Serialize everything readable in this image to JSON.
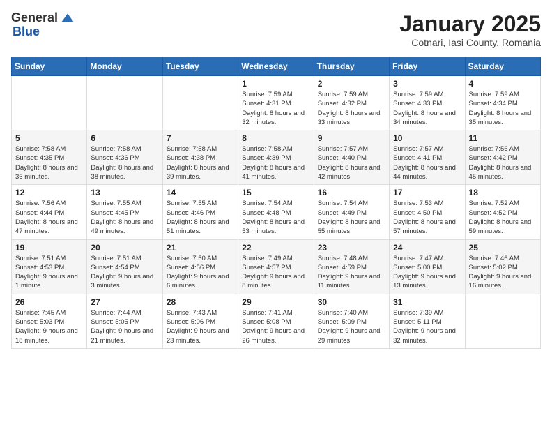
{
  "header": {
    "logo_general": "General",
    "logo_blue": "Blue",
    "month": "January 2025",
    "location": "Cotnari, Iasi County, Romania"
  },
  "weekdays": [
    "Sunday",
    "Monday",
    "Tuesday",
    "Wednesday",
    "Thursday",
    "Friday",
    "Saturday"
  ],
  "weeks": [
    [
      {
        "day": "",
        "info": ""
      },
      {
        "day": "",
        "info": ""
      },
      {
        "day": "",
        "info": ""
      },
      {
        "day": "1",
        "info": "Sunrise: 7:59 AM\nSunset: 4:31 PM\nDaylight: 8 hours and 32 minutes."
      },
      {
        "day": "2",
        "info": "Sunrise: 7:59 AM\nSunset: 4:32 PM\nDaylight: 8 hours and 33 minutes."
      },
      {
        "day": "3",
        "info": "Sunrise: 7:59 AM\nSunset: 4:33 PM\nDaylight: 8 hours and 34 minutes."
      },
      {
        "day": "4",
        "info": "Sunrise: 7:59 AM\nSunset: 4:34 PM\nDaylight: 8 hours and 35 minutes."
      }
    ],
    [
      {
        "day": "5",
        "info": "Sunrise: 7:58 AM\nSunset: 4:35 PM\nDaylight: 8 hours and 36 minutes."
      },
      {
        "day": "6",
        "info": "Sunrise: 7:58 AM\nSunset: 4:36 PM\nDaylight: 8 hours and 38 minutes."
      },
      {
        "day": "7",
        "info": "Sunrise: 7:58 AM\nSunset: 4:38 PM\nDaylight: 8 hours and 39 minutes."
      },
      {
        "day": "8",
        "info": "Sunrise: 7:58 AM\nSunset: 4:39 PM\nDaylight: 8 hours and 41 minutes."
      },
      {
        "day": "9",
        "info": "Sunrise: 7:57 AM\nSunset: 4:40 PM\nDaylight: 8 hours and 42 minutes."
      },
      {
        "day": "10",
        "info": "Sunrise: 7:57 AM\nSunset: 4:41 PM\nDaylight: 8 hours and 44 minutes."
      },
      {
        "day": "11",
        "info": "Sunrise: 7:56 AM\nSunset: 4:42 PM\nDaylight: 8 hours and 45 minutes."
      }
    ],
    [
      {
        "day": "12",
        "info": "Sunrise: 7:56 AM\nSunset: 4:44 PM\nDaylight: 8 hours and 47 minutes."
      },
      {
        "day": "13",
        "info": "Sunrise: 7:55 AM\nSunset: 4:45 PM\nDaylight: 8 hours and 49 minutes."
      },
      {
        "day": "14",
        "info": "Sunrise: 7:55 AM\nSunset: 4:46 PM\nDaylight: 8 hours and 51 minutes."
      },
      {
        "day": "15",
        "info": "Sunrise: 7:54 AM\nSunset: 4:48 PM\nDaylight: 8 hours and 53 minutes."
      },
      {
        "day": "16",
        "info": "Sunrise: 7:54 AM\nSunset: 4:49 PM\nDaylight: 8 hours and 55 minutes."
      },
      {
        "day": "17",
        "info": "Sunrise: 7:53 AM\nSunset: 4:50 PM\nDaylight: 8 hours and 57 minutes."
      },
      {
        "day": "18",
        "info": "Sunrise: 7:52 AM\nSunset: 4:52 PM\nDaylight: 8 hours and 59 minutes."
      }
    ],
    [
      {
        "day": "19",
        "info": "Sunrise: 7:51 AM\nSunset: 4:53 PM\nDaylight: 9 hours and 1 minute."
      },
      {
        "day": "20",
        "info": "Sunrise: 7:51 AM\nSunset: 4:54 PM\nDaylight: 9 hours and 3 minutes."
      },
      {
        "day": "21",
        "info": "Sunrise: 7:50 AM\nSunset: 4:56 PM\nDaylight: 9 hours and 6 minutes."
      },
      {
        "day": "22",
        "info": "Sunrise: 7:49 AM\nSunset: 4:57 PM\nDaylight: 9 hours and 8 minutes."
      },
      {
        "day": "23",
        "info": "Sunrise: 7:48 AM\nSunset: 4:59 PM\nDaylight: 9 hours and 11 minutes."
      },
      {
        "day": "24",
        "info": "Sunrise: 7:47 AM\nSunset: 5:00 PM\nDaylight: 9 hours and 13 minutes."
      },
      {
        "day": "25",
        "info": "Sunrise: 7:46 AM\nSunset: 5:02 PM\nDaylight: 9 hours and 16 minutes."
      }
    ],
    [
      {
        "day": "26",
        "info": "Sunrise: 7:45 AM\nSunset: 5:03 PM\nDaylight: 9 hours and 18 minutes."
      },
      {
        "day": "27",
        "info": "Sunrise: 7:44 AM\nSunset: 5:05 PM\nDaylight: 9 hours and 21 minutes."
      },
      {
        "day": "28",
        "info": "Sunrise: 7:43 AM\nSunset: 5:06 PM\nDaylight: 9 hours and 23 minutes."
      },
      {
        "day": "29",
        "info": "Sunrise: 7:41 AM\nSunset: 5:08 PM\nDaylight: 9 hours and 26 minutes."
      },
      {
        "day": "30",
        "info": "Sunrise: 7:40 AM\nSunset: 5:09 PM\nDaylight: 9 hours and 29 minutes."
      },
      {
        "day": "31",
        "info": "Sunrise: 7:39 AM\nSunset: 5:11 PM\nDaylight: 9 hours and 32 minutes."
      },
      {
        "day": "",
        "info": ""
      }
    ]
  ]
}
